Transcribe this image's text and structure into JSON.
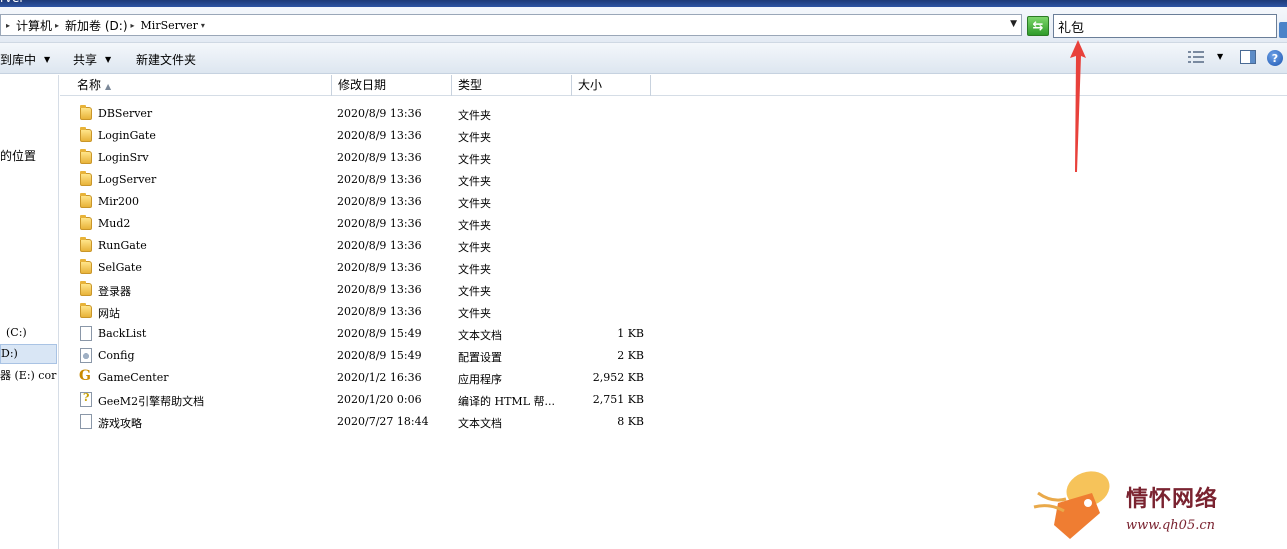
{
  "window": {
    "title_fragment": "rver"
  },
  "breadcrumb": {
    "items": [
      "计算机",
      "新加卷 (D:)",
      "MirServer"
    ]
  },
  "search": {
    "value": "礼包"
  },
  "toolbar": {
    "include_label": "到库中",
    "share_label": "共享",
    "new_folder_label": "新建文件夹",
    "help_glyph": "?"
  },
  "nav": {
    "items": [
      {
        "label": "的位置"
      },
      {
        "label": "(C:)"
      },
      {
        "label": "D:)"
      },
      {
        "label": "器 (E:) cor"
      }
    ]
  },
  "columns": {
    "name": "名称",
    "modified": "修改日期",
    "type": "类型",
    "size": "大小"
  },
  "files": [
    {
      "name": "DBServer",
      "modified": "2020/8/9 13:36",
      "type": "文件夹",
      "size": "",
      "icon": "folder"
    },
    {
      "name": "LoginGate",
      "modified": "2020/8/9 13:36",
      "type": "文件夹",
      "size": "",
      "icon": "folder"
    },
    {
      "name": "LoginSrv",
      "modified": "2020/8/9 13:36",
      "type": "文件夹",
      "size": "",
      "icon": "folder"
    },
    {
      "name": "LogServer",
      "modified": "2020/8/9 13:36",
      "type": "文件夹",
      "size": "",
      "icon": "folder"
    },
    {
      "name": "Mir200",
      "modified": "2020/8/9 13:36",
      "type": "文件夹",
      "size": "",
      "icon": "folder"
    },
    {
      "name": "Mud2",
      "modified": "2020/8/9 13:36",
      "type": "文件夹",
      "size": "",
      "icon": "folder"
    },
    {
      "name": "RunGate",
      "modified": "2020/8/9 13:36",
      "type": "文件夹",
      "size": "",
      "icon": "folder"
    },
    {
      "name": "SelGate",
      "modified": "2020/8/9 13:36",
      "type": "文件夹",
      "size": "",
      "icon": "folder"
    },
    {
      "name": "登录器",
      "modified": "2020/8/9 13:36",
      "type": "文件夹",
      "size": "",
      "icon": "folder"
    },
    {
      "name": "网站",
      "modified": "2020/8/9 13:36",
      "type": "文件夹",
      "size": "",
      "icon": "folder"
    },
    {
      "name": "BackList",
      "modified": "2020/8/9 15:49",
      "type": "文本文档",
      "size": "1 KB",
      "icon": "doc"
    },
    {
      "name": "Config",
      "modified": "2020/8/9 15:49",
      "type": "配置设置",
      "size": "2 KB",
      "icon": "cfg"
    },
    {
      "name": "GameCenter",
      "modified": "2020/1/2 16:36",
      "type": "应用程序",
      "size": "2,952 KB",
      "icon": "app"
    },
    {
      "name": "GeeM2引擎帮助文档",
      "modified": "2020/1/20 0:06",
      "type": "编译的 HTML 帮...",
      "size": "2,751 KB",
      "icon": "chm"
    },
    {
      "name": "游戏攻略",
      "modified": "2020/7/27 18:44",
      "type": "文本文档",
      "size": "8 KB",
      "icon": "doc"
    }
  ],
  "watermark": {
    "brand": "情怀网络",
    "url": "www.qh05.cn"
  },
  "colors": {
    "annotation_arrow": "#e8413b",
    "watermark_text": "#7a2330",
    "tag_orange": "#f39a2b"
  }
}
